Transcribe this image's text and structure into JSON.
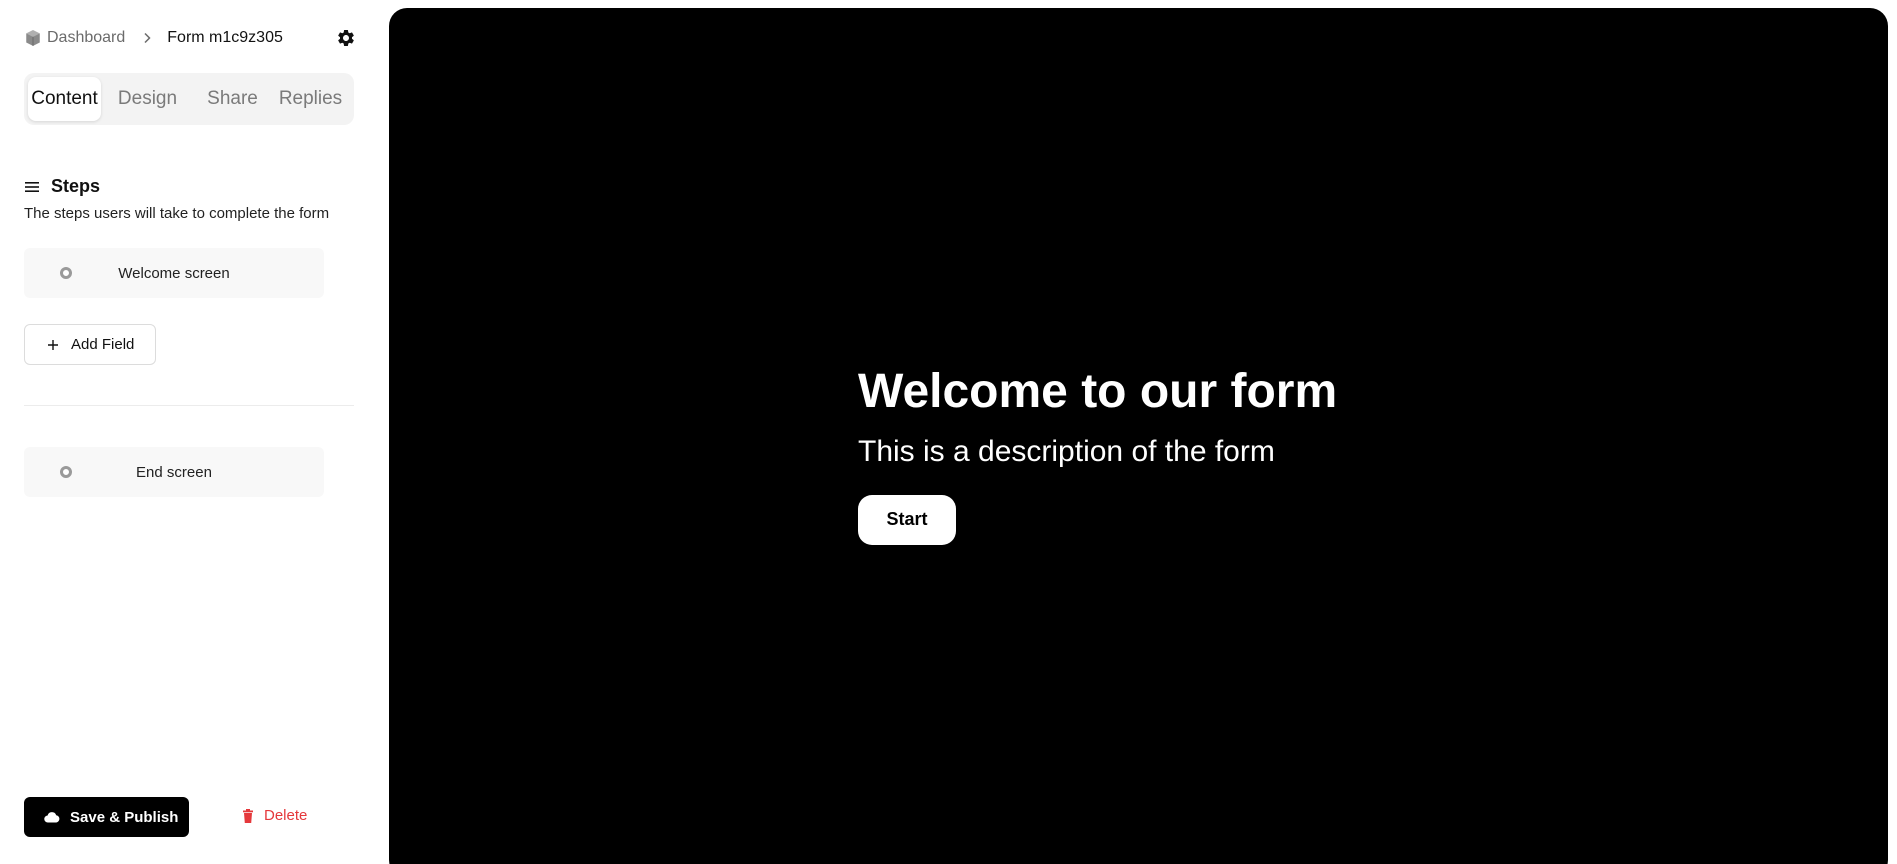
{
  "breadcrumb": {
    "home_label": "Dashboard",
    "current_label": "Form m1c9z305"
  },
  "tabs": [
    {
      "label": "Content",
      "active": true
    },
    {
      "label": "Design",
      "active": false
    },
    {
      "label": "Share",
      "active": false
    },
    {
      "label": "Replies",
      "active": false
    }
  ],
  "steps": {
    "title": "Steps",
    "description": "The steps users will take to complete the form",
    "welcome_label": "Welcome screen",
    "end_label": "End screen",
    "add_field_label": "Add Field"
  },
  "actions": {
    "save_label": "Save & Publish",
    "delete_label": "Delete"
  },
  "preview": {
    "title": "Welcome to our form",
    "description": "This is a description of the form",
    "start_label": "Start"
  },
  "icons": {
    "home": "cube-icon",
    "separator": "chevron-right-icon",
    "settings": "gear-icon",
    "steps": "menu-icon",
    "step_marker": "circle-icon",
    "add": "plus-icon",
    "save": "cloud-icon",
    "delete": "trash-icon"
  },
  "colors": {
    "preview_background": "#000000",
    "primary_button": "#000000",
    "danger": "#e5383b"
  }
}
